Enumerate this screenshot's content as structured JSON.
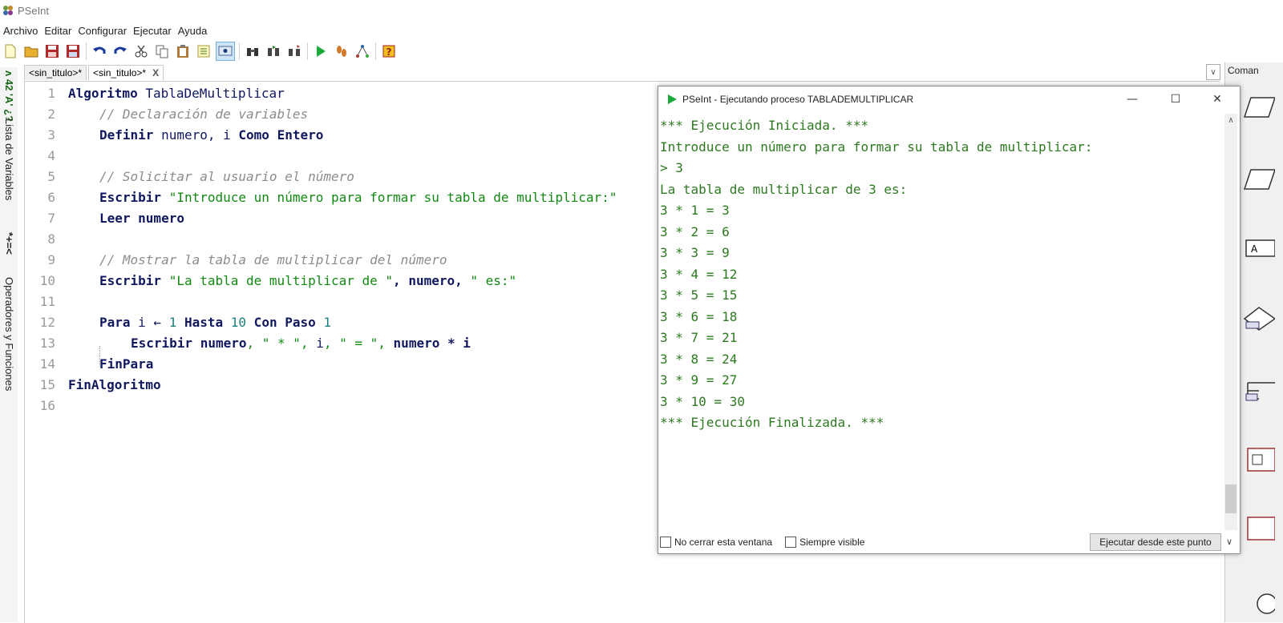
{
  "app": {
    "title": "PSeInt",
    "menu": [
      "Archivo",
      "Editar",
      "Configurar",
      "Ejecutar",
      "Ayuda"
    ]
  },
  "side_panel": {
    "symbols_variables": "ʌ 42 'A' ¿?",
    "lista_variables": "Lista de Variables",
    "symbols_operadores": "*+=<",
    "operadores_funciones": "Operadores y Funciones"
  },
  "tabs": [
    {
      "label": "<sin_titulo>*",
      "active": false
    },
    {
      "label": "<sin_titulo>*",
      "active": true,
      "close": "X"
    }
  ],
  "comandos_label": "Coman",
  "editor": {
    "line_numbers": [
      "1",
      "2",
      "3",
      "4",
      "5",
      "6",
      "7",
      "8",
      "9",
      "10",
      "11",
      "12",
      "13",
      "14",
      "15",
      "16"
    ],
    "code": {
      "l1_kw": "Algoritmo",
      "l1_name": " TablaDeMultiplicar",
      "l2_comment": "// Declaración de variables",
      "l3_kw1": "Definir",
      "l3_vars": " numero, i ",
      "l3_kw2": "Como Entero",
      "l5_comment": "// Solicitar al usuario el número",
      "l6_kw": "Escribir",
      "l6_str": " \"Introduce un número para formar su tabla de multiplicar:\"",
      "l7_kw": "Leer numero",
      "l9_comment": "// Mostrar la tabla de multiplicar del número",
      "l10_kw": "Escribir",
      "l10_str1": " \"La tabla de multiplicar de \"",
      "l10_mid": ", numero, ",
      "l10_str2": "\" es:\"",
      "l12_kw1": "Para",
      "l12_var": " i ← ",
      "l12_n1": "1",
      "l12_kw2": " Hasta ",
      "l12_n2": "10",
      "l12_kw3": " Con Paso ",
      "l12_n3": "1",
      "l13_kw": "Escribir numero",
      "l13_s1": ", \" * \", ",
      "l13_i": "i",
      "l13_s2": ", \" = \", ",
      "l13_expr": "numero * i",
      "l14_kw": "FinPara",
      "l15_kw": "FinAlgoritmo"
    }
  },
  "exec_window": {
    "title": "PSeInt - Ejecutando proceso TABLADEMULTIPLICAR",
    "minimize": "—",
    "maximize": "☐",
    "close": "✕",
    "output": [
      "*** Ejecución Iniciada. ***",
      "Introduce un número para formar su tabla de multiplicar:",
      "> 3",
      "La tabla de multiplicar de 3 es:",
      "3 * 1 = 3",
      "3 * 2 = 6",
      "3 * 3 = 9",
      "3 * 4 = 12",
      "3 * 5 = 15",
      "3 * 6 = 18",
      "3 * 7 = 21",
      "3 * 8 = 24",
      "3 * 9 = 27",
      "3 * 10 = 30",
      "*** Ejecución Finalizada. ***"
    ],
    "chk_no_cerrar": "No cerrar esta ventana",
    "chk_siempre": "Siempre visible",
    "run_button": "Ejecutar desde este punto"
  },
  "colors": {
    "keyword": "#101860",
    "comment": "#8c8c8c",
    "string": "#118a11",
    "number": "#1b7e7e",
    "console_text": "#2c7a1f"
  }
}
